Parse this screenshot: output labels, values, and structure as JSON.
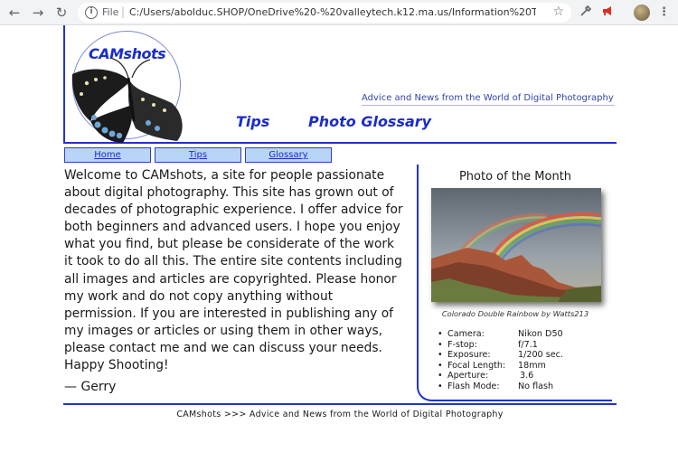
{
  "browser": {
    "file_label": "File",
    "url": "C:/Users/abolduc.SHOP/OneDrive%20-%20valleytech.k12.ma.us/Information%20Technology/..."
  },
  "header": {
    "logo_text": "CAMshots",
    "tagline": "Advice and News from the World of Digital Photography",
    "links": [
      "Tips",
      "Photo Glossary"
    ]
  },
  "nav": [
    "Home",
    "Tips",
    "Glossary"
  ],
  "main": {
    "intro": "Welcome to CAMshots, a site for people passionate about digital photography. This site has grown out of decades of photographic experience. I offer advice for both beginners and advanced users. I hope you enjoy what you find, but please be considerate of the work it took to do all this. The entire site contents including all images and articles are copyrighted. Please honor my work and do not copy anything without permission. If you are interested in publishing any of my images or articles or using them in other ways, please contact me and we can discuss your needs. Happy Shooting!",
    "signature": "— Gerry"
  },
  "sidebar": {
    "title": "Photo of the Month",
    "caption": "Colorado Double Rainbow by Watts213",
    "specs": [
      {
        "label": "Camera:",
        "value": "Nikon D50"
      },
      {
        "label": "F-stop:",
        "value": "f/7.1"
      },
      {
        "label": "Exposure:",
        "value": "1/200 sec."
      },
      {
        "label": "Focal Length:",
        "value": "18mm"
      },
      {
        "label": "Aperture:",
        "value": "3.6"
      },
      {
        "label": "Flash Mode:",
        "value": "No flash"
      }
    ]
  },
  "footer": {
    "text": "CAMshots >>> Advice and News from the World of Digital Photography"
  }
}
